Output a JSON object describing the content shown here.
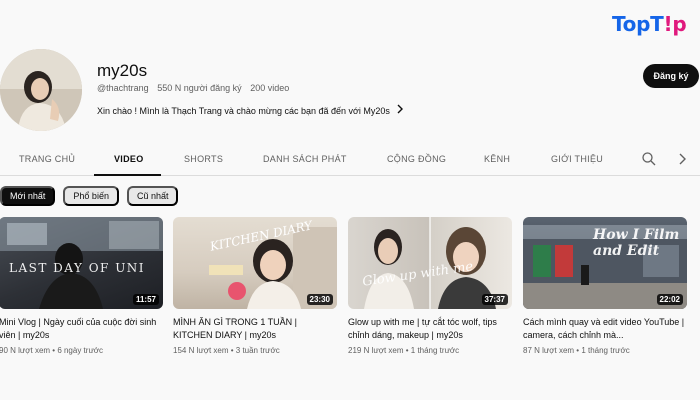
{
  "watermark": {
    "part1": "TopT",
    "part2": "!p"
  },
  "channel": {
    "name": "my20s",
    "handle": "@thachtrang",
    "subscribers": "550 N người đăng ký",
    "video_count": "200 video",
    "description": "Xin chào ! Mình là Thạch Trang và chào mừng các bạn đã đến với My20s",
    "subscribe_label": "Đăng ký"
  },
  "tabs": [
    {
      "label": "TRANG CHỦ"
    },
    {
      "label": "VIDEO"
    },
    {
      "label": "SHORTS"
    },
    {
      "label": "DANH SÁCH PHÁT"
    },
    {
      "label": "CỘNG ĐỒNG"
    },
    {
      "label": "KÊNH"
    },
    {
      "label": "GIỚI THIỆU"
    }
  ],
  "chips": [
    {
      "label": "Mới nhất"
    },
    {
      "label": "Phổ biến"
    },
    {
      "label": "Cũ nhất"
    }
  ],
  "videos": [
    {
      "title": "Mini Vlog | Ngày cuối của cuộc đời sinh viên | my20s",
      "views": "90 N lượt xem",
      "age": "6 ngày trước",
      "duration": "11:57",
      "thumb_text": "LAST DAY OF UNI"
    },
    {
      "title": "MÌNH ĂN GÌ TRONG 1 TUẦN | KITCHEN DIARY | my20s",
      "views": "154 N lượt xem",
      "age": "3 tuần trước",
      "duration": "23:30",
      "thumb_text": "KITCHEN DIARY"
    },
    {
      "title": "Glow up with me | tự cắt tóc wolf, tips chỉnh dáng, makeup | my20s",
      "views": "219 N lượt xem",
      "age": "1 tháng trước",
      "duration": "37:37",
      "thumb_text": "Glow up with me"
    },
    {
      "title": "Cách mình quay và edit video YouTube | camera, cách chỉnh mà...",
      "views": "87 N lượt xem",
      "age": "1 tháng trước",
      "duration": "22:02",
      "thumb_text": "How I Film and Edit"
    }
  ]
}
